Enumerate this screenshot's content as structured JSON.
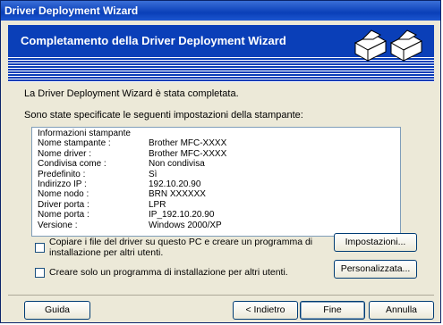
{
  "window": {
    "title": "Driver Deployment Wizard"
  },
  "banner": {
    "title": "Completamento della Driver Deployment Wizard",
    "icon": "printer-icon"
  },
  "messages": {
    "completed": "La Driver Deployment Wizard è stata completata.",
    "specified": "Sono state specificate le seguenti impostazioni della stampante:"
  },
  "info": {
    "header": "Informazioni stampante",
    "rows": [
      {
        "key": "Nome stampante :",
        "value": "Brother  MFC-XXXX"
      },
      {
        "key": "Nome driver :",
        "value": "Brother  MFC-XXXX"
      },
      {
        "key": "Condivisa come :",
        "value": "Non condivisa"
      },
      {
        "key": "Predefinito :",
        "value": "Sì"
      },
      {
        "key": "Indirizzo IP :",
        "value": "192.10.20.90"
      },
      {
        "key": "Nome nodo :",
        "value": "BRN   XXXXXX"
      },
      {
        "key": "Driver porta :",
        "value": "LPR"
      },
      {
        "key": "Nome porta :",
        "value": "IP_192.10.20.90"
      },
      {
        "key": "Versione :",
        "value": "Windows 2000/XP"
      }
    ]
  },
  "options": {
    "copy_label": "Copiare i file del driver su questo PC e creare un programma di installazione per altri utenti.",
    "create_label": "Creare solo un programma di installazione per altri utenti."
  },
  "buttons": {
    "settings": "Impostazioni...",
    "customize": "Personalizzata...",
    "help": "Guida",
    "back": "< Indietro",
    "finish": "Fine",
    "cancel": "Annulla"
  }
}
